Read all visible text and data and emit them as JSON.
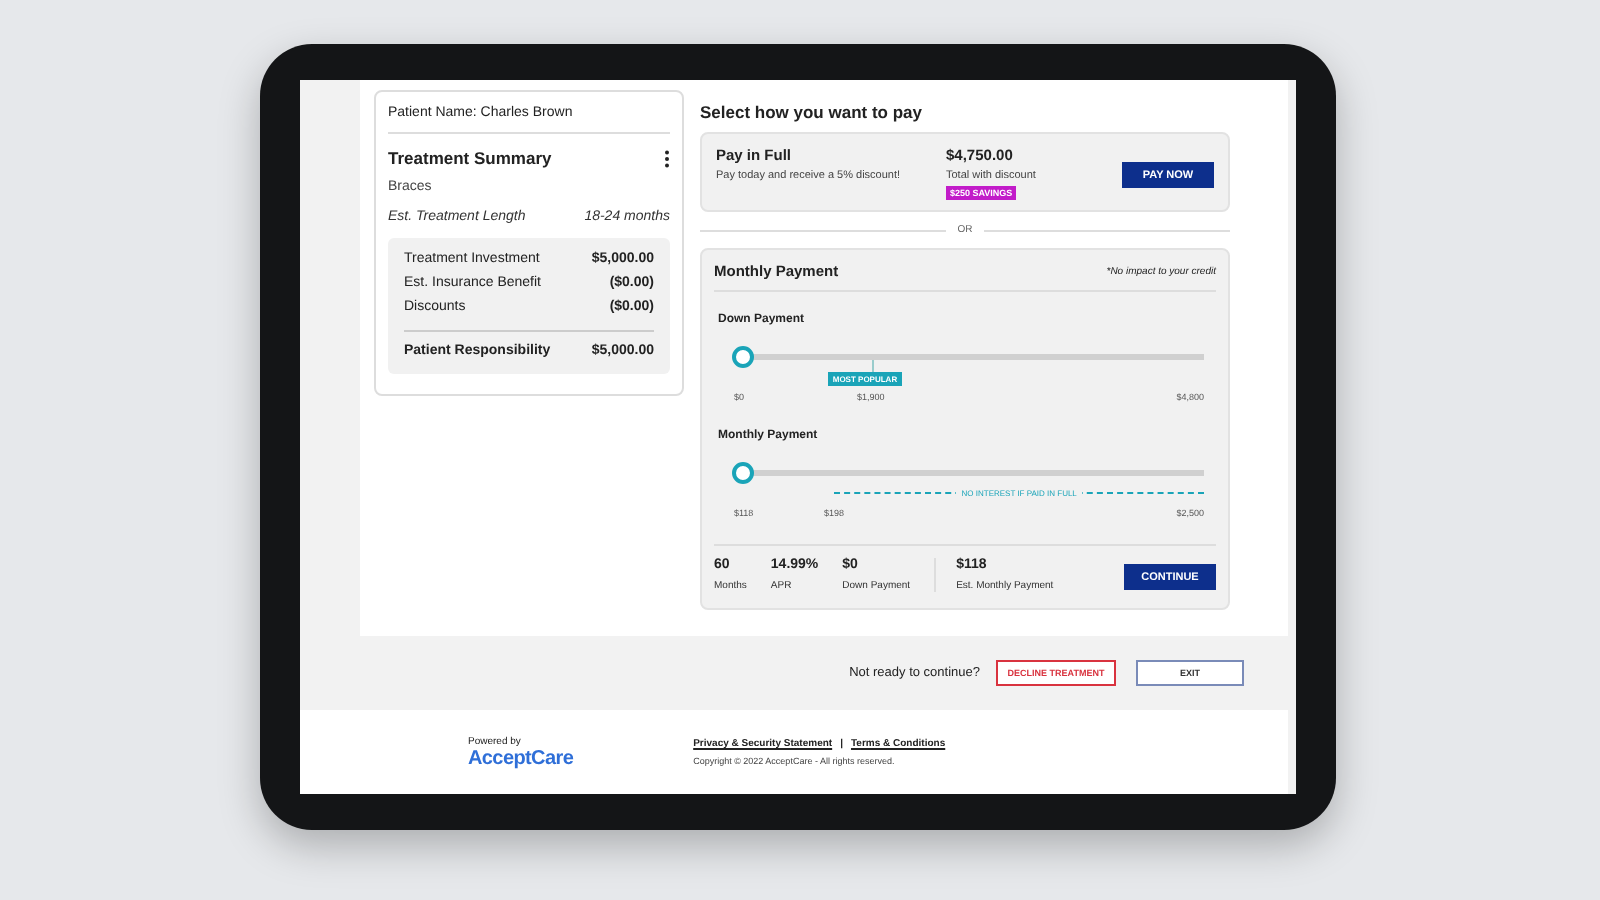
{
  "patient_name": "Patient Name: Charles Brown",
  "treatment_summary": {
    "title": "Treatment Summary",
    "treatment": "Braces",
    "length_label": "Est. Treatment Length",
    "length_value": "18-24 months",
    "lines": [
      {
        "label": "Treatment Investment",
        "amount": "$5,000.00"
      },
      {
        "label": "Est. Insurance Benefit",
        "amount": "($0.00)"
      },
      {
        "label": "Discounts",
        "amount": "($0.00)"
      }
    ],
    "total": {
      "label": "Patient Responsibility",
      "amount": "$5,000.00"
    }
  },
  "payment": {
    "heading": "Select how you want to pay",
    "pay_in_full": {
      "title": "Pay in Full",
      "description": "Pay today and receive a 5% discount!",
      "amount": "$4,750.00",
      "amount_note": "Total with discount",
      "badge": "$250 SAVINGS",
      "button": "PAY NOW"
    },
    "divider": "OR",
    "monthly": {
      "title": "Monthly Payment",
      "note": "*No impact to your credit",
      "sliders": [
        {
          "label": "Down Payment",
          "kind": "tag",
          "level": 0,
          "min": "$0",
          "marker": "$1,900",
          "max": "$4,800",
          "tag": "MOST POPULAR"
        },
        {
          "label": "Monthly Payment",
          "kind": "range",
          "level": 0,
          "min": "$118",
          "marker": "$198",
          "max": "$2,500",
          "tag": "NO INTEREST IF PAID IN FULL"
        }
      ],
      "stats": [
        {
          "value": "60",
          "label": "Months"
        },
        {
          "value": "14.99%",
          "label": "APR"
        },
        {
          "value": "$0",
          "label": "Down Payment"
        }
      ],
      "estimate": {
        "value": "$118",
        "label": "Est. Monthly Payment"
      },
      "button": "CONTINUE"
    }
  },
  "actions": {
    "prompt": "Not ready to continue?",
    "decline": "DECLINE TREATMENT",
    "exit": "EXIT"
  },
  "footer": {
    "powered_by": "Powered by",
    "logo": "AcceptCare",
    "links": [
      "Privacy & Security Statement",
      "Terms & Conditions"
    ],
    "separator": "|",
    "copyright": "Copyright © 2022 AcceptCare - All rights reserved."
  }
}
